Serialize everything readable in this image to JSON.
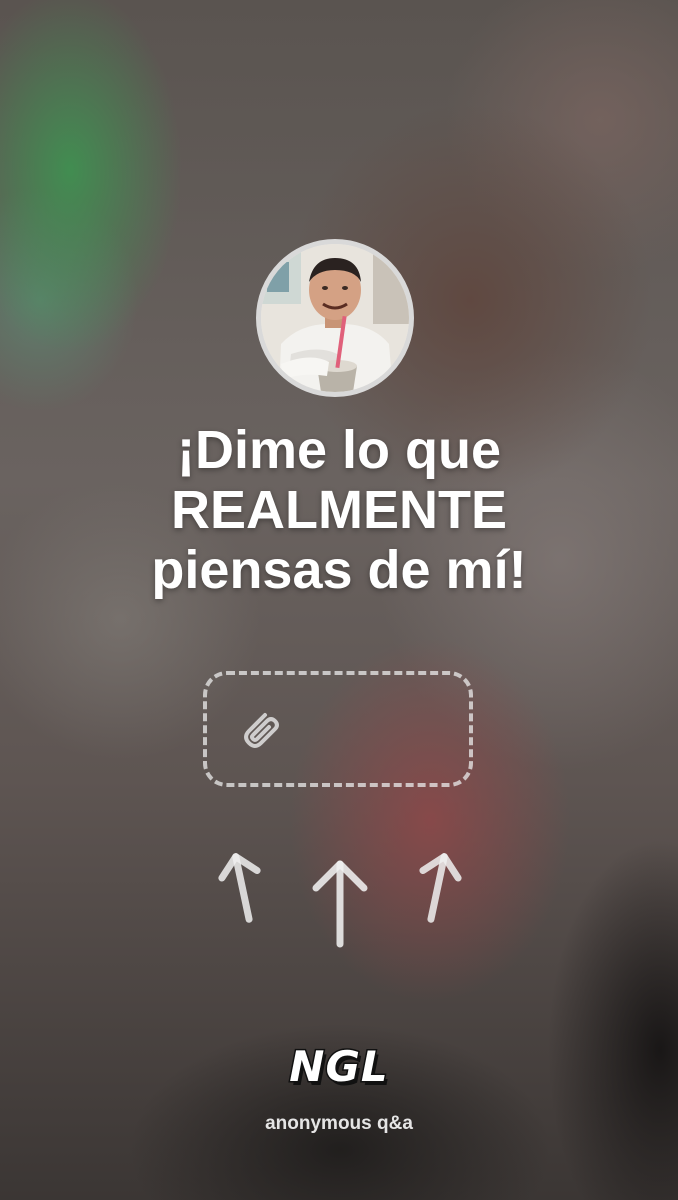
{
  "headline": {
    "line1": "¡Dime lo que",
    "line2": "REALMENTE",
    "line3": "piensas de mí!"
  },
  "profile": {
    "avatar_icon": "profile-photo"
  },
  "sticker_slot": {
    "icon": "paperclip-icon"
  },
  "arrows": {
    "icon": "arrow-up-icon",
    "count": 3
  },
  "brand": {
    "logo_text": "NGL",
    "tagline": "anonymous q&a"
  },
  "colors": {
    "text": "#ffffff",
    "avatar_border": "#d9d9d9",
    "dashed_border": "#ebebeb"
  }
}
